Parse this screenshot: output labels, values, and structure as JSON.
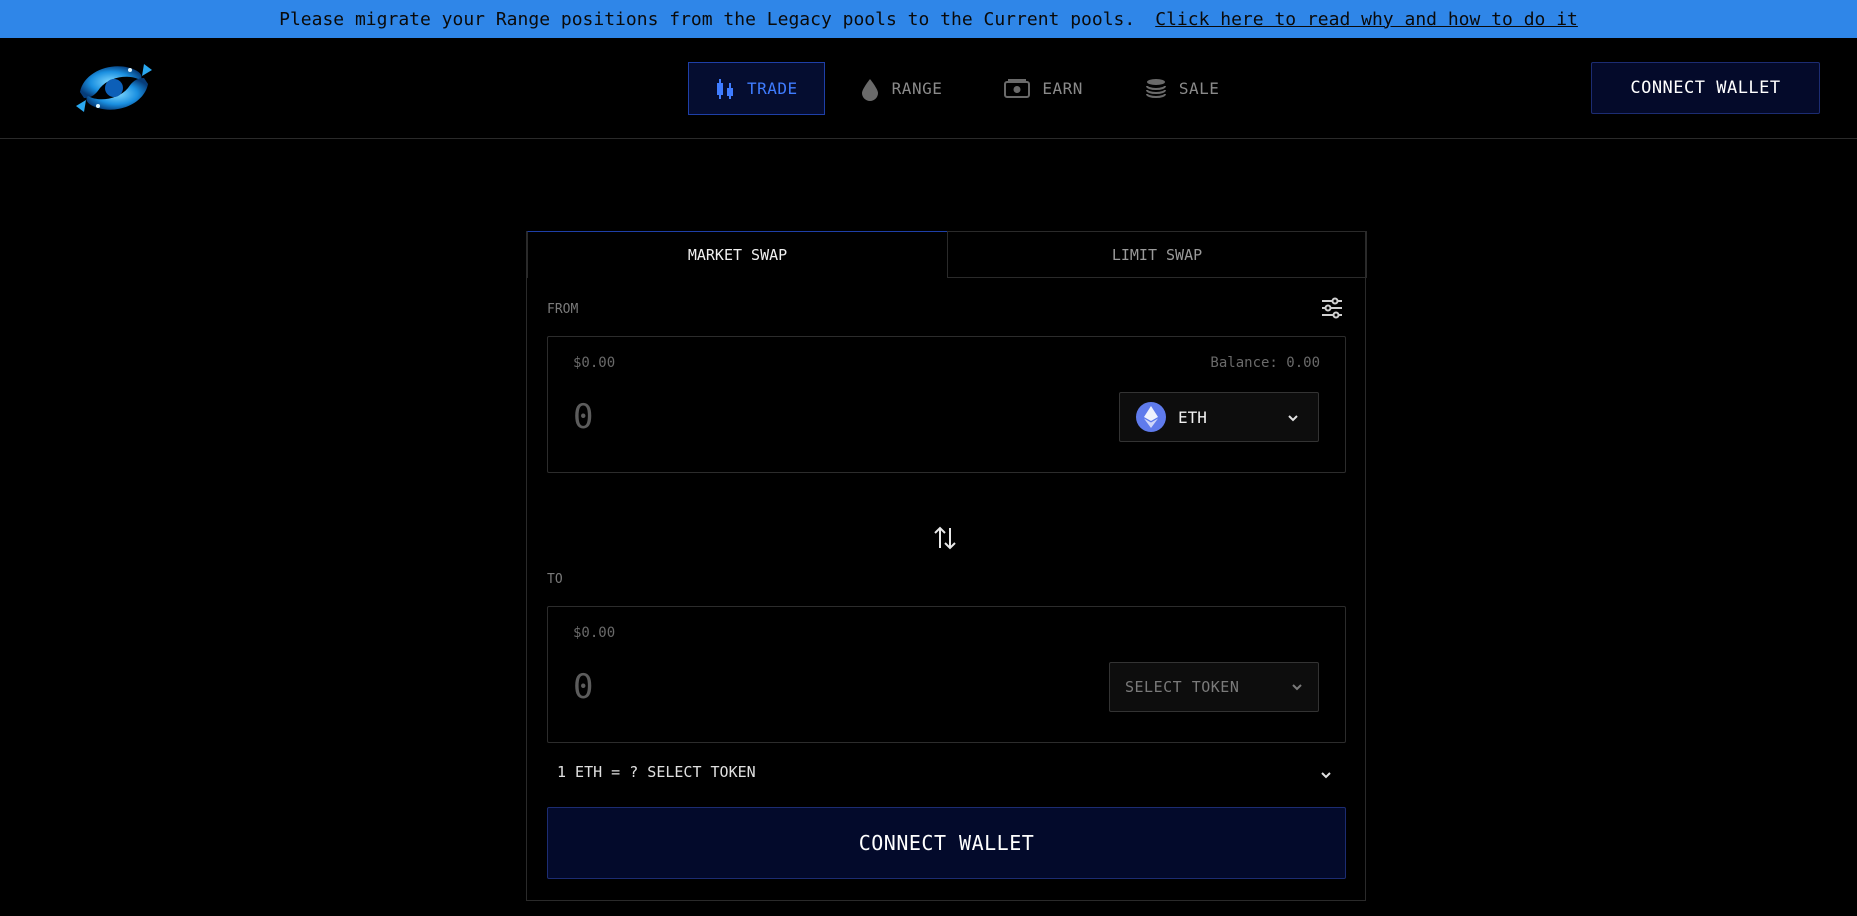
{
  "banner": {
    "message": "Please migrate your Range positions from the Legacy pools to the Current pools.",
    "link": "Click here to read why and how to do it"
  },
  "nav": {
    "items": [
      {
        "label": "TRADE",
        "icon": "candlestick-icon",
        "active": true
      },
      {
        "label": "RANGE",
        "icon": "droplet-icon",
        "active": false
      },
      {
        "label": "EARN",
        "icon": "cash-icon",
        "active": false
      },
      {
        "label": "SALE",
        "icon": "coins-icon",
        "active": false
      }
    ],
    "connect_wallet": "CONNECT WALLET"
  },
  "swap": {
    "tabs": [
      {
        "label": "MARKET SWAP",
        "active": true
      },
      {
        "label": "LIMIT SWAP",
        "active": false
      }
    ],
    "from": {
      "label": "FROM",
      "usd": "$0.00",
      "balance": "Balance: 0.00",
      "amount_placeholder": "0",
      "token": "ETH"
    },
    "to": {
      "label": "TO",
      "usd": "$0.00",
      "amount_placeholder": "0",
      "token": "SELECT TOKEN"
    },
    "rate": "1 ETH = ? SELECT TOKEN",
    "connect_wallet": "CONNECT WALLET"
  },
  "colors": {
    "banner": "#2f86e8",
    "accent": "#3f7cff",
    "button_bg": "#030a2b",
    "background": "#000000"
  }
}
